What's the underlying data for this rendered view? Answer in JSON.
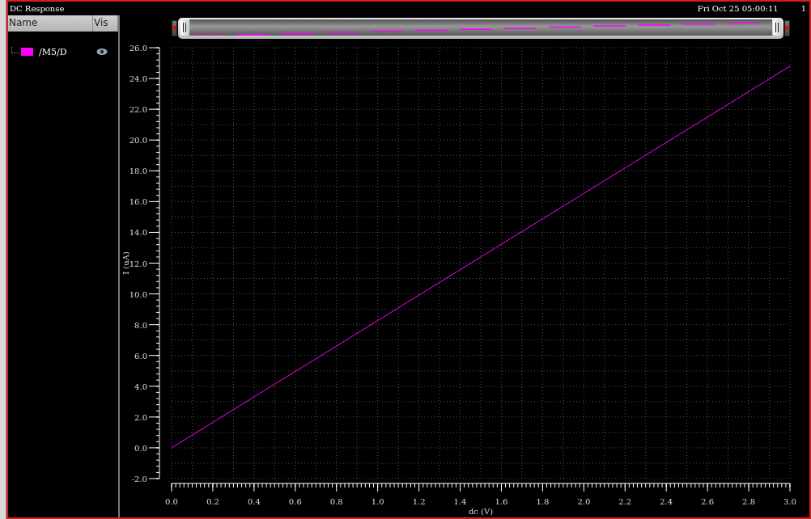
{
  "window": {
    "title": "DC Response",
    "timestamp": "Fri Oct 25 05:00:11",
    "corner": "1"
  },
  "legend": {
    "columns": [
      "Name",
      "Vis"
    ],
    "signals": [
      {
        "name": "/M5/D",
        "color": "#ff00ff",
        "visible": true
      }
    ]
  },
  "chart_data": {
    "type": "line",
    "xlabel": "dc (V)",
    "ylabel": "I (uA)",
    "x": [
      0,
      3.0
    ],
    "grid": true,
    "series": [
      {
        "color": "#ff00ff",
        "values": [
          0,
          24.8
        ]
      }
    ],
    "xlim": [
      0,
      3.0
    ],
    "ylim": [
      -2,
      26
    ],
    "xticks": [
      {
        "value": 0,
        "label": "0.0"
      },
      {
        "value": 0.2,
        "label": "0.2"
      },
      {
        "value": 0.4,
        "label": "0.4"
      },
      {
        "value": 0.6,
        "label": "0.6"
      },
      {
        "value": 0.8,
        "label": "0.8"
      },
      {
        "value": 1.0,
        "label": "1.0"
      },
      {
        "value": 1.2,
        "label": "1.2"
      },
      {
        "value": 1.4,
        "label": "1.4"
      },
      {
        "value": 1.6,
        "label": "1.6"
      },
      {
        "value": 1.8,
        "label": "1.8"
      },
      {
        "value": 2.0,
        "label": "2.0"
      },
      {
        "value": 2.2,
        "label": "2.2"
      },
      {
        "value": 2.4,
        "label": "2.4"
      },
      {
        "value": 2.6,
        "label": "2.6"
      },
      {
        "value": 2.8,
        "label": "2.8"
      },
      {
        "value": 3.0,
        "label": "3.0"
      }
    ],
    "yticks": [
      {
        "value": -2,
        "label": "-2.0"
      },
      {
        "value": 0,
        "label": "0.0"
      },
      {
        "value": 2,
        "label": "2.0"
      },
      {
        "value": 4,
        "label": "4.0"
      },
      {
        "value": 6,
        "label": "6.0"
      },
      {
        "value": 8,
        "label": "8.0"
      },
      {
        "value": 10,
        "label": "10.0"
      },
      {
        "value": 12,
        "label": "12.0"
      },
      {
        "value": 14,
        "label": "14.0"
      },
      {
        "value": 16,
        "label": "16.0"
      },
      {
        "value": 18,
        "label": "18.0"
      },
      {
        "value": 20,
        "label": "20.0"
      },
      {
        "value": 22,
        "label": "22.0"
      },
      {
        "value": 24,
        "label": "24.0"
      },
      {
        "value": 26,
        "label": "26.0"
      }
    ]
  }
}
